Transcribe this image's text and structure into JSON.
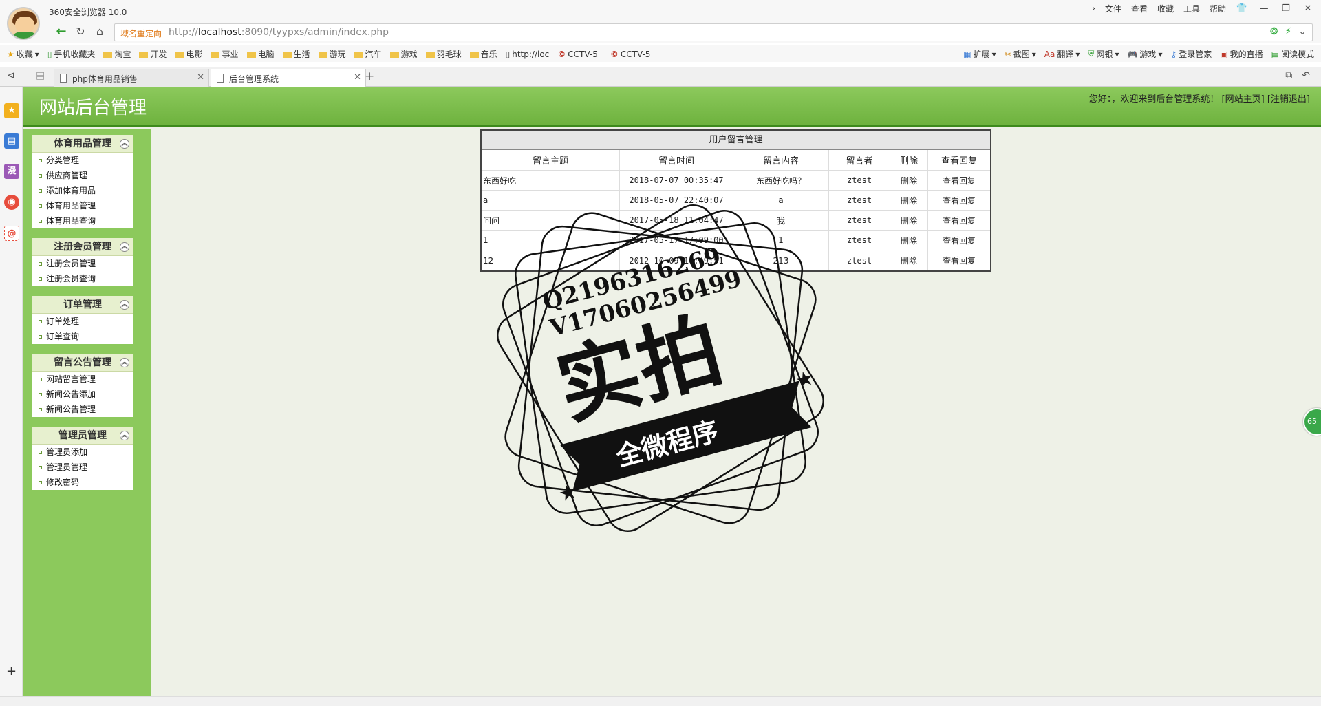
{
  "browser": {
    "name": "360安全浏览器 10.0",
    "menu": [
      "文件",
      "查看",
      "收藏",
      "工具",
      "帮助"
    ],
    "redirect_label": "域名重定向",
    "url_prefix": "http://",
    "url_host": "localhost",
    "url_rest": ":8090/tyypxs/admin/index.php"
  },
  "bookmarks": {
    "left": [
      {
        "label": "收藏",
        "icon": "star-icon"
      },
      {
        "label": "手机收藏夹",
        "icon": "phone-icon"
      },
      {
        "label": "淘宝",
        "icon": "folder-icon"
      },
      {
        "label": "开发",
        "icon": "folder-icon"
      },
      {
        "label": "电影",
        "icon": "folder-icon"
      },
      {
        "label": "事业",
        "icon": "folder-icon"
      },
      {
        "label": "电脑",
        "icon": "folder-icon"
      },
      {
        "label": "生活",
        "icon": "folder-icon"
      },
      {
        "label": "游玩",
        "icon": "folder-icon"
      },
      {
        "label": "汽车",
        "icon": "folder-icon"
      },
      {
        "label": "游戏",
        "icon": "folder-icon"
      },
      {
        "label": "羽毛球",
        "icon": "folder-icon"
      },
      {
        "label": "音乐",
        "icon": "folder-icon"
      },
      {
        "label": "http://loc",
        "icon": "page-icon"
      },
      {
        "label": "CCTV-5",
        "icon": "cctv-icon"
      },
      {
        "label": "CCTV-5",
        "icon": "cctv-icon"
      }
    ],
    "right": [
      "扩展",
      "截图",
      "翻译",
      "网银",
      "游戏",
      "登录管家",
      "我的直播",
      "阅读模式"
    ]
  },
  "tabs": [
    {
      "label": "php体育用品销售",
      "active": false
    },
    {
      "label": "后台管理系统",
      "active": true
    }
  ],
  "admin": {
    "title": "网站后台管理",
    "welcome": "您好：，欢迎来到后台管理系统！",
    "home_link": "网站主页",
    "logout_link": "注销退出"
  },
  "menus": [
    {
      "title": "体育用品管理",
      "items": [
        "分类管理",
        "供应商管理",
        "添加体育用品",
        "体育用品管理",
        "体育用品查询"
      ]
    },
    {
      "title": "注册会员管理",
      "items": [
        "注册会员管理",
        "注册会员查询"
      ]
    },
    {
      "title": "订单管理",
      "items": [
        "订单处理",
        "订单查询"
      ]
    },
    {
      "title": "留言公告管理",
      "items": [
        "网站留言管理",
        "新闻公告添加",
        "新闻公告管理"
      ]
    },
    {
      "title": "管理员管理",
      "items": [
        "管理员添加",
        "管理员管理",
        "修改密码"
      ]
    }
  ],
  "table": {
    "title": "用户留言管理",
    "headers": [
      "留言主题",
      "留言时间",
      "留言内容",
      "留言者",
      "删除",
      "查看回复"
    ],
    "rows": [
      {
        "subject": "东西好吃",
        "time": "2018-07-07 00:35:47",
        "content": "东西好吃吗？",
        "author": "ztest",
        "delete": "删除",
        "view": "查看回复"
      },
      {
        "subject": "a",
        "time": "2018-05-07 22:40:07",
        "content": "a",
        "author": "ztest",
        "delete": "删除",
        "view": "查看回复"
      },
      {
        "subject": "问问",
        "time": "2017-05-18 11:04:47",
        "content": "我",
        "author": "ztest",
        "delete": "删除",
        "view": "查看回复"
      },
      {
        "subject": "1",
        "time": "2017-05-17 17:09:00",
        "content": "1",
        "author": "ztest",
        "delete": "删除",
        "view": "查看回复"
      },
      {
        "subject": "12",
        "time": "2012-10-09 10:49:51",
        "content": "213",
        "author": "ztest",
        "delete": "删除",
        "view": "查看回复"
      }
    ]
  },
  "watermark": {
    "line1": "Q2196316269",
    "line2": "V17060256499",
    "main": "实拍",
    "banner": "全微程序"
  },
  "float_badge": "65"
}
